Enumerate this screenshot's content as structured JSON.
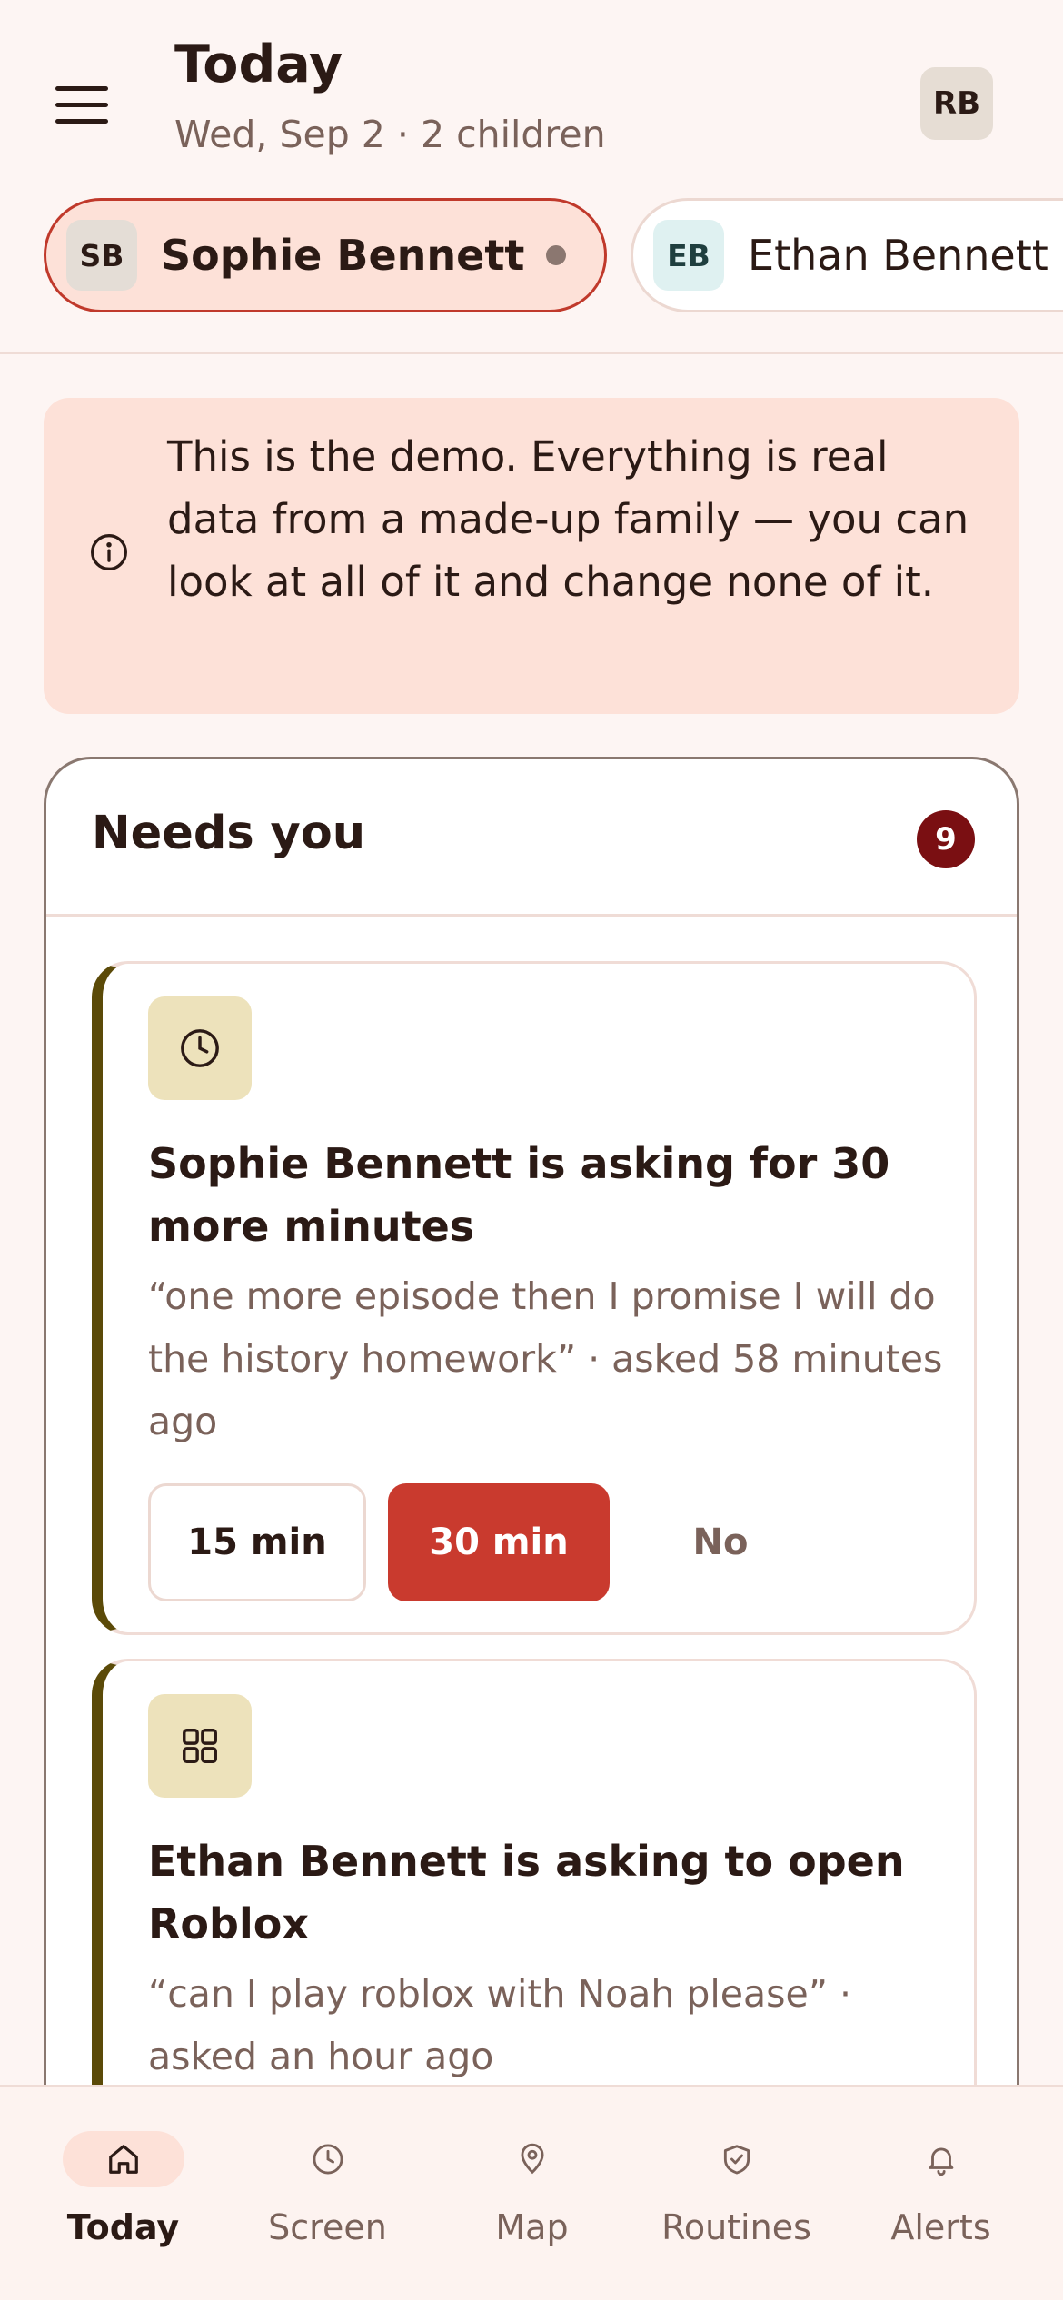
{
  "header": {
    "title": "Today",
    "subtitle": "Wed, Sep 2 · 2 children",
    "user_initials": "RB"
  },
  "children": [
    {
      "initials": "SB",
      "name": "Sophie Bennett",
      "active": true
    },
    {
      "initials": "EB",
      "name": "Ethan Bennett",
      "active": false
    }
  ],
  "banner": {
    "text": "This is the demo. Everything is real data from a made-up family — you can look at all of it and change none of it."
  },
  "needs_you": {
    "title": "Needs you",
    "count": "9",
    "requests": [
      {
        "icon": "clock-icon",
        "title": "Sophie Bennett is asking for 30 more minutes",
        "description": "“one more episode then I promise I will do the history homework” · asked 58 minutes ago",
        "actions": [
          "15 min",
          "30 min",
          "No"
        ]
      },
      {
        "icon": "apps-grid-icon",
        "title": "Ethan Bennett is asking to open Roblox",
        "description": "“can I play roblox with Noah please” · asked an hour ago"
      }
    ]
  },
  "nav": [
    {
      "label": "Today",
      "icon": "home-icon",
      "active": true
    },
    {
      "label": "Screen",
      "icon": "clock-icon"
    },
    {
      "label": "Map",
      "icon": "map-pin-icon"
    },
    {
      "label": "Routines",
      "icon": "shield-check-icon"
    },
    {
      "label": "Alerts",
      "icon": "bell-icon"
    }
  ],
  "colors": {
    "accent": "#c93a2e",
    "badge": "#7a0f12",
    "card_stripe": "#5b4a08",
    "background": "#fdf5f3"
  }
}
